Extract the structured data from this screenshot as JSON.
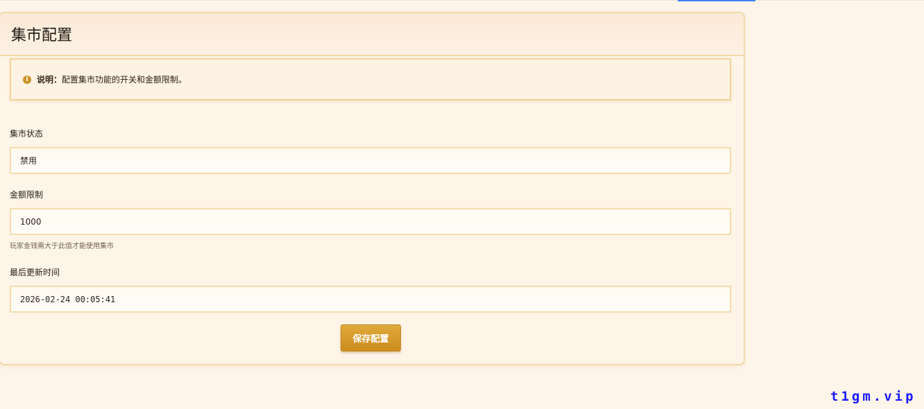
{
  "page": {
    "title": "集市配置"
  },
  "notice": {
    "icon": "info-icon",
    "label": "说明：",
    "text": "配置集市功能的开关和金额限制。"
  },
  "fields": {
    "status": {
      "label": "集市状态",
      "value": "禁用"
    },
    "amount_limit": {
      "label": "金额限制",
      "value": "1000",
      "hint": "玩家金钱需大于此值才能使用集市"
    },
    "last_updated": {
      "label": "最后更新时间",
      "value": "2026-02-24 00:05:41"
    }
  },
  "actions": {
    "save_label": "保存配置"
  },
  "watermark": "t1gm.vip",
  "colors": {
    "accent": "#cc8c1e",
    "border": "#f2d9a8",
    "background": "#fef5ea",
    "watermark": "#1a1aff"
  }
}
